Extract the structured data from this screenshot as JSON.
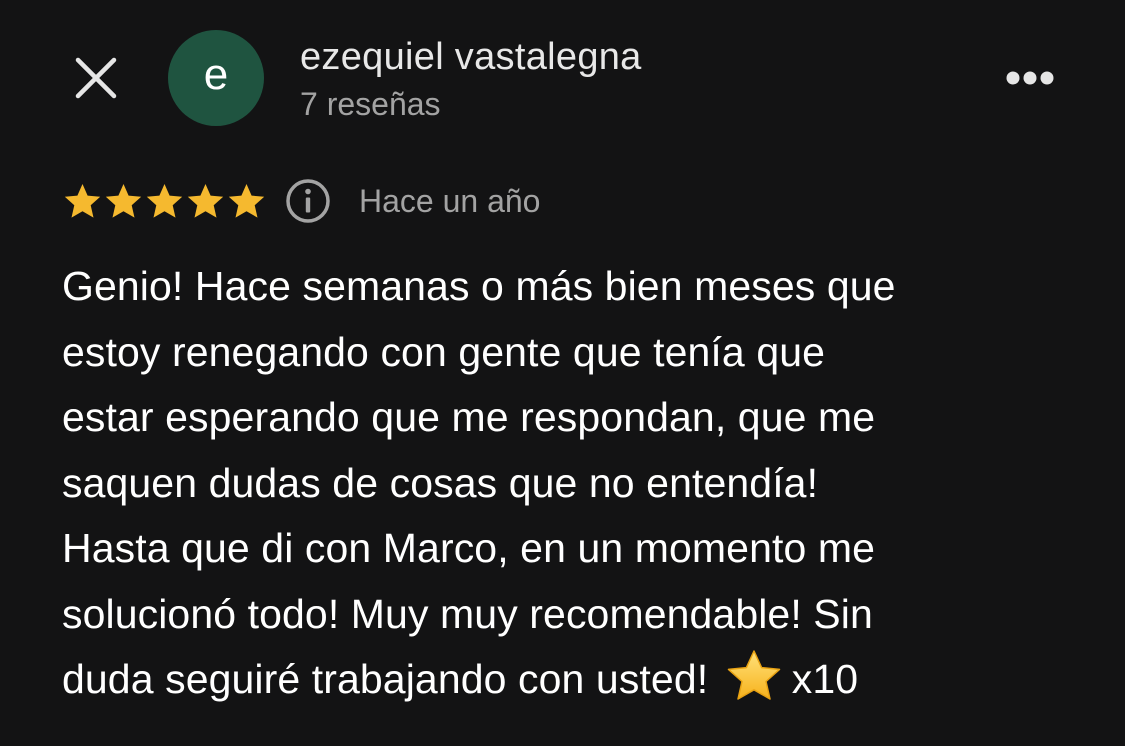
{
  "header": {
    "close_icon": "close-icon",
    "avatar_initial": "e",
    "avatar_color": "#1f5440",
    "user_name": "ezequiel vastalegna",
    "review_count": "7 reseñas",
    "more_icon": "more-horizontal-icon"
  },
  "review": {
    "rating": 5,
    "rating_max": 5,
    "star_color": "#f5b92f",
    "info_icon": "info-icon",
    "date": "Hace un año",
    "text_lines": [
      "Genio! Hace semanas o más bien meses que",
      "estoy renegando con gente que tenía que",
      "estar esperando que me respondan, que me",
      "saquen dudas de cosas que no entendía!",
      "Hasta que di con Marco, en un momento me",
      "solucionó todo! Muy muy recomendable! Sin",
      "duda seguiré trabajando con usted!"
    ],
    "emoji": "⭐",
    "suffix": "x10"
  }
}
